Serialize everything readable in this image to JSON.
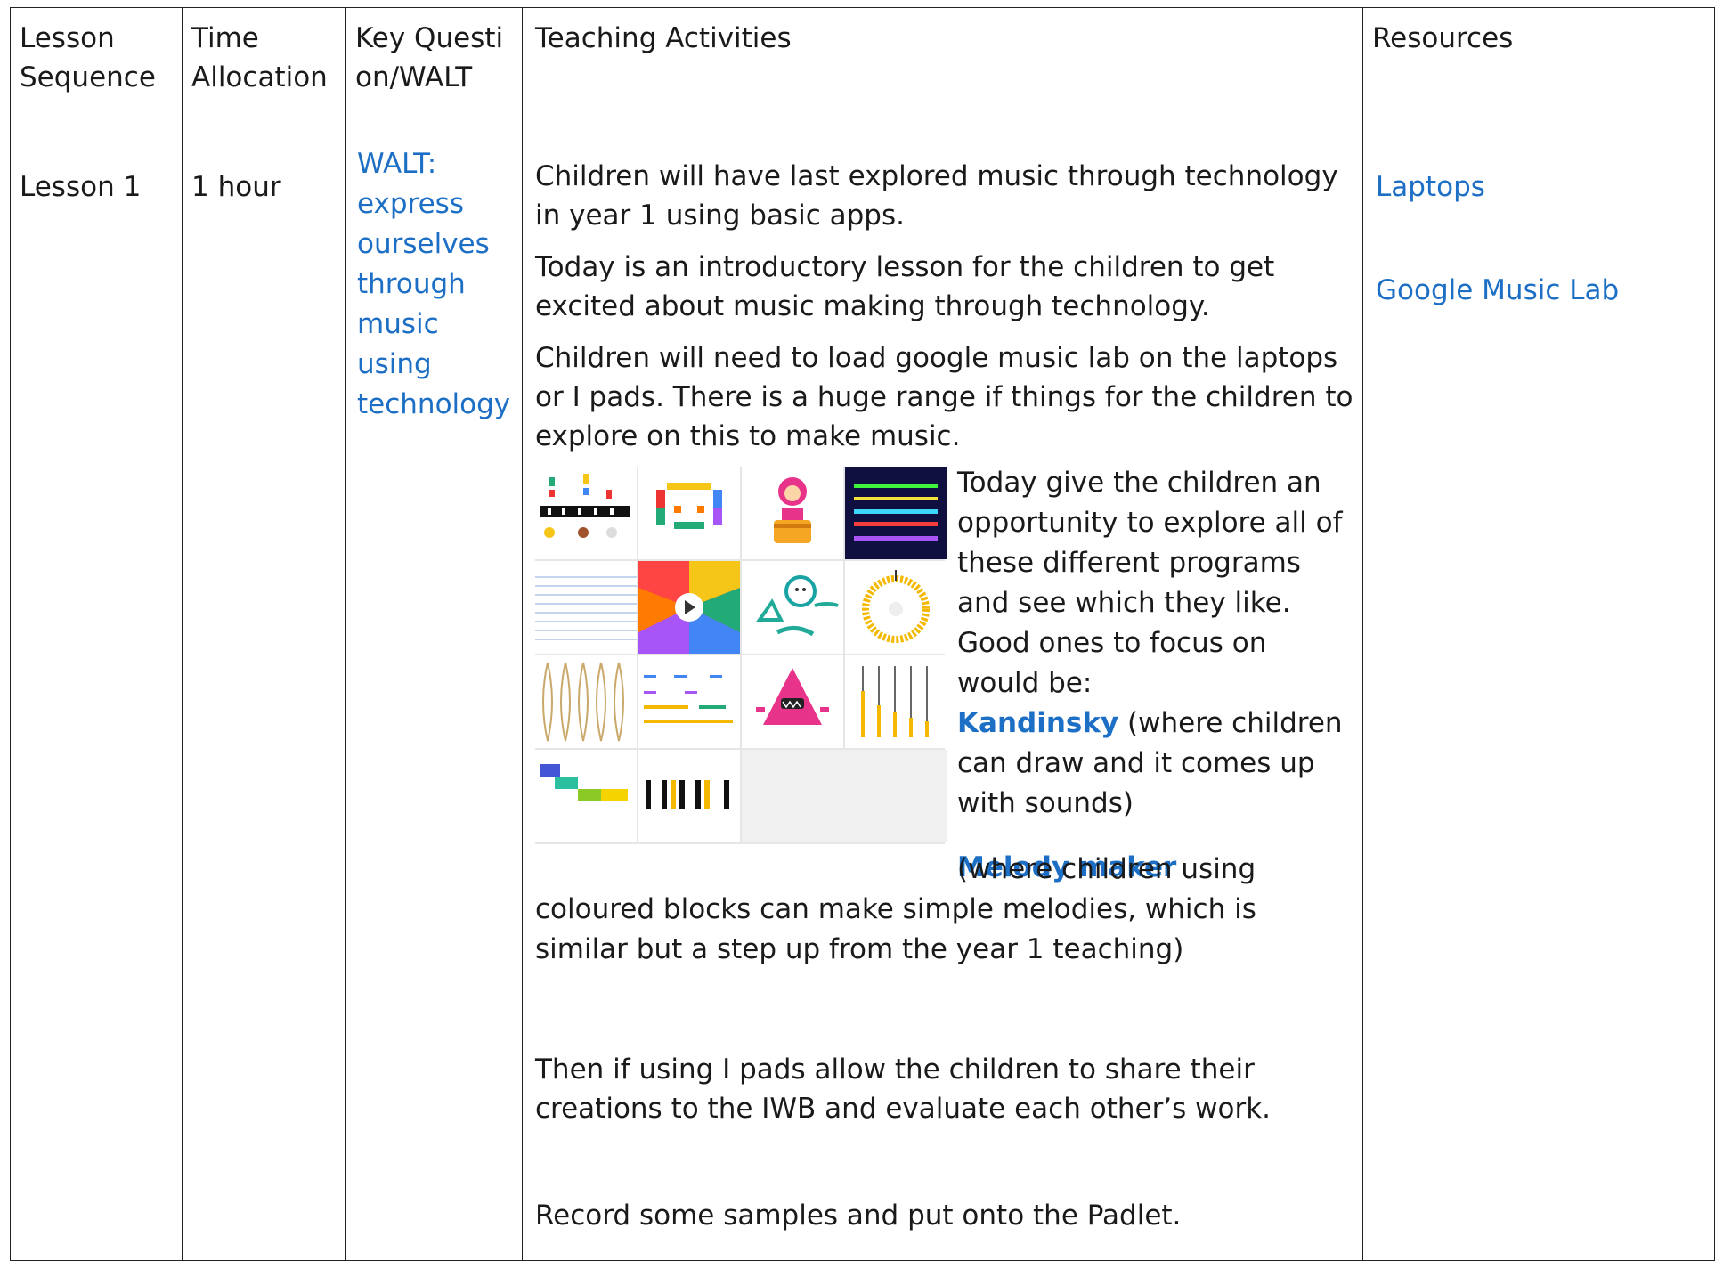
{
  "headers": {
    "lesson_sequence": "Lesson Sequence",
    "time_allocation": "Time Allocation",
    "key_question": "Key Question/WALT",
    "teaching_activities": "Teaching Activities",
    "resources": "Resources"
  },
  "row": {
    "lesson": "Lesson 1",
    "time": "1 hour",
    "walt_label": "WALT:",
    "walt_text": "express ourselves through music using technology",
    "activities": {
      "p1": "Children will have last explored music through technology in year 1 using basic apps.",
      "p2": "Today is an introductory lesson for the children to get excited about music making through technology.",
      "p3": "Children will need to load google music lab on the laptops or I pads. There is a huge range if things for the children to explore on this to make music.",
      "p4": "Today give the children an opportunity to explore all of these different programs and see which they like.",
      "p5": "Good ones to focus on would be:",
      "kandinsky": "Kandinsky",
      "kandinsky_desc": " (where children can draw and it comes up with sounds)",
      "melody_maker": "Melody maker",
      "melody_desc": " (where children using coloured blocks can make simple melodies, which is similar but a step up from the year 1 teaching)",
      "p6": "Then if using I pads allow the children to share their creations to the IWB and evaluate each other’s work.",
      "p7": "Record some samples and put onto the Padlet."
    },
    "resources": [
      "Laptops",
      "Google Music Lab"
    ]
  },
  "gallery_icons": [
    "piano-roll-icon",
    "pixel-face-icon",
    "monkey-drummer-icon",
    "spectrogram-icon",
    "sound-waves-icon",
    "color-wheel-play-icon",
    "kandinsky-drawing-icon",
    "voice-spinner-icon",
    "strings-icon",
    "rhythm-bars-icon",
    "triangle-character-icon",
    "harmonic-sliders-icon",
    "melody-blocks-icon",
    "piano-keys-icon",
    "blank-tile"
  ],
  "colors": {
    "link": "#1c6fc4",
    "text": "#1a1a1a",
    "border": "#222222"
  }
}
